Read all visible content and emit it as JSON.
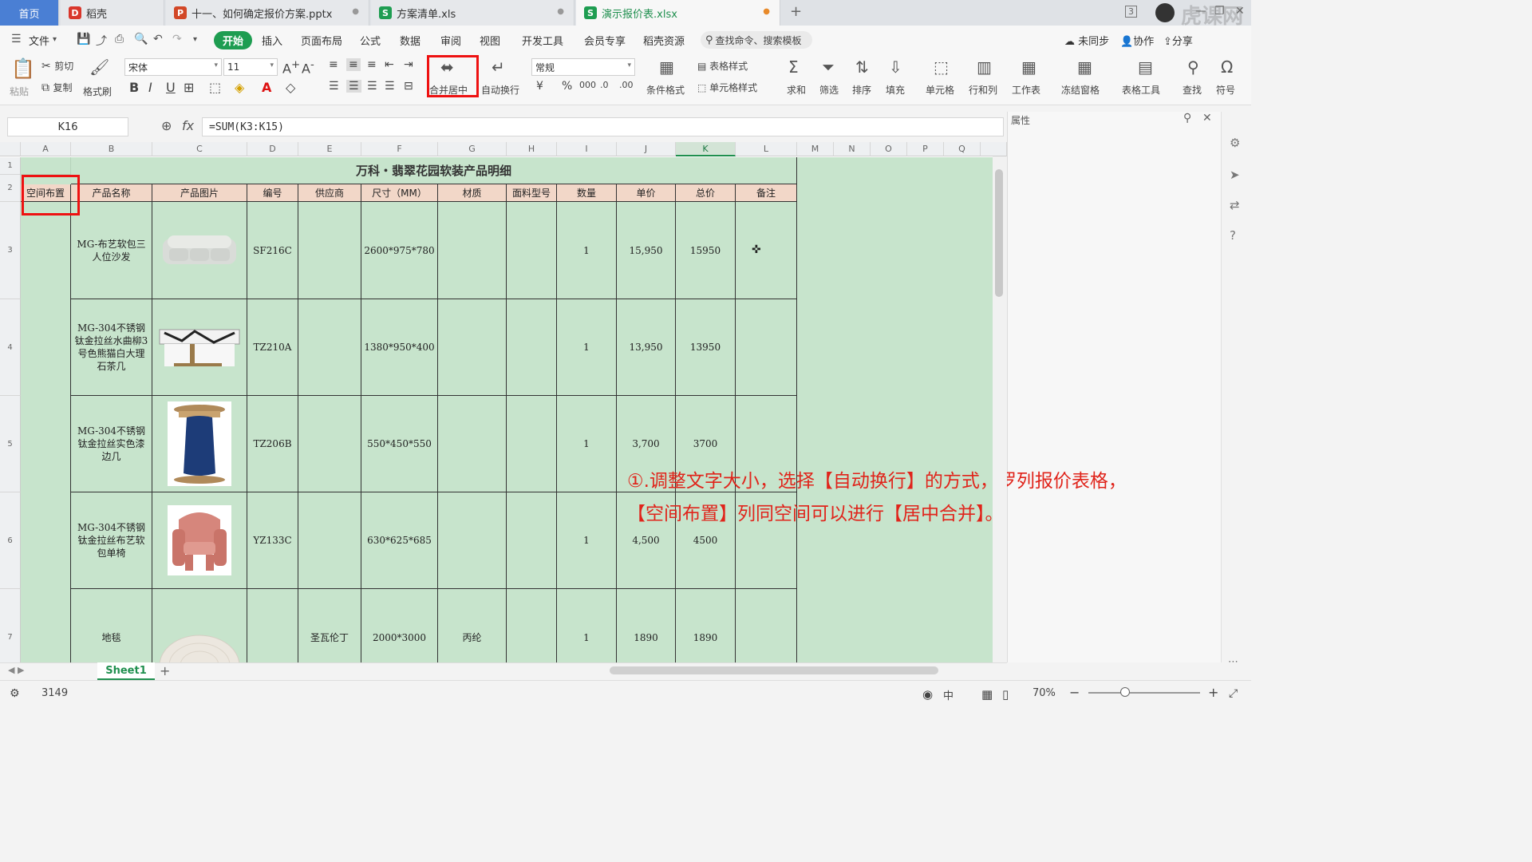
{
  "tabs": [
    {
      "label": "首页"
    },
    {
      "label": "稻壳"
    },
    {
      "label": "十一、如何确定报价方案.pptx"
    },
    {
      "label": "方案清单.xls"
    },
    {
      "label": "演示报价表.xlsx"
    }
  ],
  "window": {
    "badge": "3",
    "watermark": "虎课网"
  },
  "menu": {
    "file": "文件",
    "items": [
      "开始",
      "插入",
      "页面布局",
      "公式",
      "数据",
      "审阅",
      "视图",
      "开发工具",
      "会员专享",
      "稻壳资源"
    ],
    "search": "查找命令、搜索模板",
    "right": [
      "未同步",
      "协作",
      "分享"
    ]
  },
  "ribbon": {
    "paste": "粘贴",
    "cut": "剪切",
    "copy": "复制",
    "format_painter": "格式刷",
    "font_name": "宋体",
    "font_size": "11",
    "merge_center": "合并居中",
    "wrap_text": "自动换行",
    "number_format": "常规",
    "conditional_format": "条件格式",
    "table_style": "表格样式",
    "cell_style": "单元格样式",
    "sum": "求和",
    "filter": "筛选",
    "sort": "排序",
    "fill": "填充",
    "cell": "单元格",
    "row_col": "行和列",
    "worksheet": "工作表",
    "freeze": "冻结窗格",
    "table_tools": "表格工具",
    "find": "查找",
    "symbol": "符号"
  },
  "formula_bar": {
    "name_box": "K16",
    "fx": "fx",
    "formula": "=SUM(K3:K15)"
  },
  "properties_panel": {
    "title": "属性"
  },
  "columns": [
    "A",
    "B",
    "C",
    "D",
    "E",
    "F",
    "G",
    "H",
    "I",
    "J",
    "K",
    "L",
    "M",
    "N",
    "O",
    "P",
    "Q"
  ],
  "rows": [
    "1",
    "2",
    "3",
    "4",
    "5",
    "6",
    "7"
  ],
  "sheet_title": "万科・翡翠花园软装产品明细",
  "table_headers": [
    "空间布置",
    "产品名称",
    "产品图片",
    "编号",
    "供应商",
    "尺寸（MM）",
    "材质",
    "面料型号",
    "数量",
    "单价",
    "总价",
    "备注"
  ],
  "products": [
    {
      "name": "MG-布艺软包三人位沙发",
      "code": "SF216C",
      "supplier": "",
      "size": "2600*975*780",
      "material": "",
      "fabric": "",
      "qty": "1",
      "unit_price": "15,950",
      "total": "15950",
      "image": "sofa"
    },
    {
      "name": "MG-304不锈钢钛金拉丝水曲柳3号色熊猫白大理石茶几",
      "code": "TZ210A",
      "supplier": "",
      "size": "1380*950*400",
      "material": "",
      "fabric": "",
      "qty": "1",
      "unit_price": "13,950",
      "total": "13950",
      "image": "coffee-table"
    },
    {
      "name": "MG-304不锈钢钛金拉丝实色漆边几",
      "code": "TZ206B",
      "supplier": "",
      "size": "550*450*550",
      "material": "",
      "fabric": "",
      "qty": "1",
      "unit_price": "3,700",
      "total": "3700",
      "image": "side-table"
    },
    {
      "name": "MG-304不锈钢钛金拉丝布艺软包单椅",
      "code": "YZ133C",
      "supplier": "",
      "size": "630*625*685",
      "material": "",
      "fabric": "",
      "qty": "1",
      "unit_price": "4,500",
      "total": "4500",
      "image": "armchair"
    },
    {
      "name": "地毯",
      "code": "",
      "supplier": "圣瓦伦丁",
      "size": "2000*3000",
      "material": "丙纶",
      "fabric": "",
      "qty": "1",
      "unit_price": "1890",
      "total": "1890",
      "image": "rug"
    }
  ],
  "annotation": {
    "line1": "①.调整文字大小，选择【自动换行】的方式，罗列报价表格，",
    "line2": "【空间布置】列同空间可以进行【居中合并】。"
  },
  "sheet_tabs": [
    "Sheet1"
  ],
  "status": {
    "value": "3149",
    "zoom": "70%",
    "lang": "中"
  },
  "colors": {
    "accent": "#1e9d51",
    "cell_fill": "#c7e4cc",
    "header_fill": "#f2d7c8",
    "highlight": "#e11111",
    "annotation": "#e0241b"
  }
}
